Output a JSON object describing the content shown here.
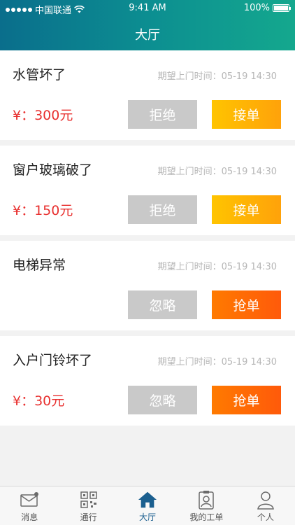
{
  "status_bar": {
    "carrier": "中国联通",
    "time": "9:41 AM",
    "battery": "100%"
  },
  "header": {
    "title": "大厅"
  },
  "orders": [
    {
      "name": "水管坏了",
      "time": "期望上门时间：05-19 14:30",
      "price": "¥：300元",
      "left_button": "拒绝",
      "right_button": "接单",
      "right_type": "accept"
    },
    {
      "name": "窗户玻璃破了",
      "time": "期望上门时间：05-19 14:30",
      "price": "¥：150元",
      "left_button": "拒绝",
      "right_button": "接单",
      "right_type": "accept"
    },
    {
      "name": "电梯异常",
      "time": "期望上门时间：05-19 14:30",
      "price": "",
      "left_button": "忽略",
      "right_button": "抢单",
      "right_type": "grab"
    },
    {
      "name": "入户门铃坏了",
      "time": "期望上门时间：05-19 14:30",
      "price": "¥：30元",
      "left_button": "忽略",
      "right_button": "抢单",
      "right_type": "grab"
    }
  ],
  "tabbar": {
    "items": [
      {
        "label": "消息",
        "icon": "message-icon"
      },
      {
        "label": "通行",
        "icon": "qr-code-icon"
      },
      {
        "label": "大厅",
        "icon": "home-icon",
        "active": true
      },
      {
        "label": "我的工单",
        "icon": "clipboard-worker-icon"
      },
      {
        "label": "个人",
        "icon": "person-icon"
      }
    ]
  }
}
